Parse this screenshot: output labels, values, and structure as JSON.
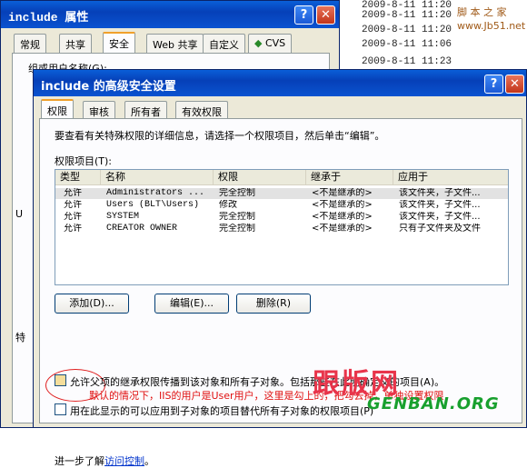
{
  "background_list": {
    "rows": [
      "2009-8-11 11:20",
      "2009-8-11 11:20",
      "2009-8-11 11:20",
      "2009-8-11 11:06",
      "2009-8-11 11:23"
    ],
    "watermark_line1": "脚 本 之 家",
    "watermark_line2": "www.Jb51.net"
  },
  "back_dialog": {
    "title": "include 属性",
    "help_label": "?",
    "close_label": "✕",
    "tabs": [
      "常规",
      "共享",
      "安全",
      "Web 共享",
      "自定义",
      "CVS"
    ],
    "group_label": "组或用户名称(G):",
    "frag1": "U",
    "frag2": "特"
  },
  "front_dialog": {
    "title": "include 的高级安全设置",
    "help_label": "?",
    "close_label": "✕",
    "tabs": [
      "权限",
      "审核",
      "所有者",
      "有效权限"
    ],
    "info": "要查看有关特殊权限的详细信息，请选择一个权限项目，然后单击“编辑”。",
    "list_label": "权限项目(T):",
    "columns": [
      "类型",
      "名称",
      "权限",
      "继承于",
      "应用于"
    ],
    "rows": [
      [
        "允许",
        "Administrators ...",
        "完全控制",
        "<不是继承的>",
        "该文件夹，子文件..."
      ],
      [
        "允许",
        "Users (BLT\\Users)",
        "修改",
        "<不是继承的>",
        "该文件夹，子文件..."
      ],
      [
        "允许",
        "SYSTEM",
        "完全控制",
        "<不是继承的>",
        "该文件夹，子文件..."
      ],
      [
        "允许",
        "CREATOR OWNER",
        "完全控制",
        "<不是继承的>",
        "只有子文件夹及文件"
      ]
    ],
    "buttons": {
      "add": "添加(D)...",
      "edit": "编辑(E)...",
      "remove": "删除(R)"
    },
    "inherit_checkbox": "允许父项的继承权限传播到该对象和所有子对象。包括那些在此明确定义的项目(A)。",
    "replace_checkbox": "用在此显示的可以应用到子对象的项目替代所有子对象的权限项目(P)",
    "annotation": "默认的情况下，IIS的用户是User用户，这里是勾上的，把勾去掉，单独设置权限",
    "more_prefix": "进一步了解",
    "more_link": "访问控制",
    "more_suffix": "。"
  },
  "bottom_watermark": {
    "brand": "跟版网",
    "url": "GENBAN.ORG"
  },
  "colors": {
    "title_blue": "#0a53d0",
    "annotation_red": "#e01010",
    "tab_accent": "#f0a02a"
  }
}
